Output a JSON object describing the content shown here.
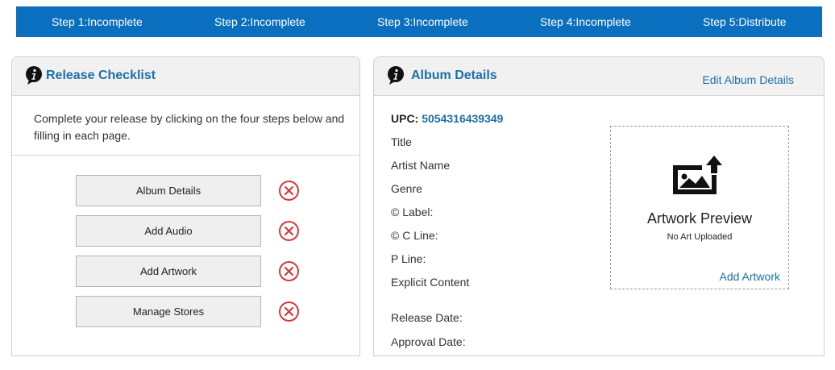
{
  "steps": [
    {
      "label": "Step 1:Incomplete"
    },
    {
      "label": "Step 2:Incomplete"
    },
    {
      "label": "Step 3:Incomplete"
    },
    {
      "label": "Step 4:Incomplete"
    },
    {
      "label": "Step 5:Distribute"
    }
  ],
  "checklist": {
    "title": "Release Checklist",
    "description": "Complete your release by clicking on the four steps below and filling in each page.",
    "items": [
      {
        "label": "Album Details",
        "status_icon": "x-circle-icon"
      },
      {
        "label": "Add Audio",
        "status_icon": "x-circle-icon"
      },
      {
        "label": "Add Artwork",
        "status_icon": "x-circle-icon"
      },
      {
        "label": "Manage Stores",
        "status_icon": "x-circle-icon"
      }
    ]
  },
  "album": {
    "title": "Album Details",
    "edit_label": "Edit Album Details",
    "upc_label": "UPC:",
    "upc_value": "5054316439349",
    "fields": [
      "Title",
      "Artist Name",
      "Genre",
      "© Label:",
      "© C Line:",
      "P Line:",
      "Explicit Content"
    ],
    "release_date_label": "Release Date:",
    "approval_date_label": "Approval Date:",
    "artwork": {
      "title": "Artwork Preview",
      "status": "No Art Uploaded",
      "add_label": "Add Artwork"
    }
  },
  "colors": {
    "accent": "#0a6fbe",
    "link": "#1c6fa8",
    "error": "#d9383a"
  }
}
